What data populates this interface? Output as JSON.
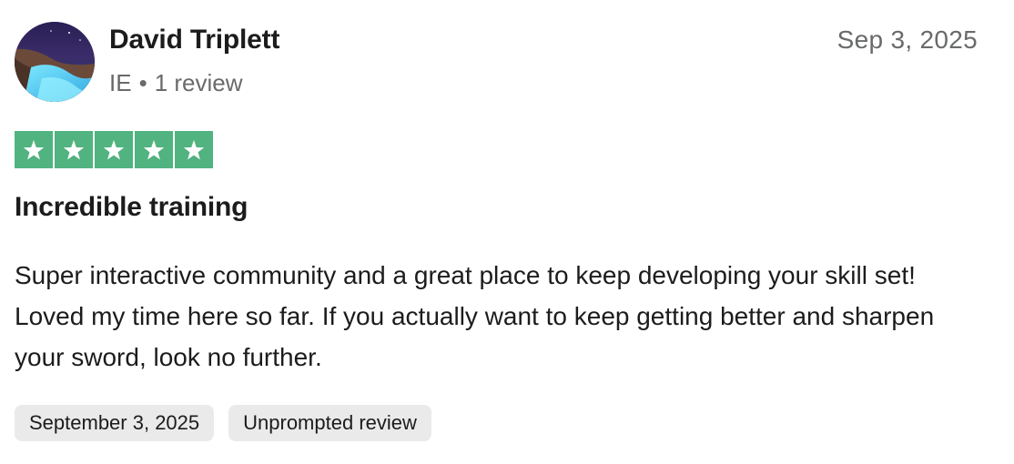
{
  "review": {
    "author": {
      "name": "David Triplett",
      "country": "IE",
      "separator": "•",
      "review_count": "1 review"
    },
    "date_short": "Sep 3, 2025",
    "rating": 5,
    "rating_max": 5,
    "star_color": "#51b37f",
    "title": "Incredible training",
    "body": "Super interactive community and a great place to keep developing your skill set! Loved my time here so far. If you actually want to keep getting better and sharpen your sword, look no further.",
    "tags": {
      "date_label": "September 3, 2025",
      "type_label": "Unprompted review"
    }
  }
}
